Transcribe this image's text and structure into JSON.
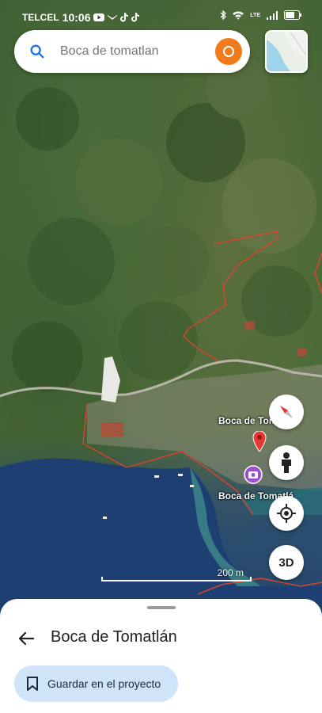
{
  "status_bar": {
    "carrier": "TELCEL",
    "time": "10:06",
    "network": "LTE"
  },
  "search": {
    "placeholder": "Boca de tomatlan"
  },
  "map": {
    "place_label_top": "Boca de Tom",
    "place_label_bottom": "Boca de Tomatlá",
    "scale_label": "200 m"
  },
  "controls": {
    "three_d_label": "3D"
  },
  "sheet": {
    "title": "Boca de Tomatlán",
    "save_label": "Guardar en el proyecto"
  },
  "colors": {
    "accent_orange": "#f27a1a",
    "pin_red": "#e53935",
    "photo_purple": "#9b4dca",
    "save_button_bg": "#cfe3f9",
    "boundary_red": "#d6452f"
  },
  "icons": [
    "youtube-icon",
    "tiktok-icon",
    "bluetooth-icon",
    "wifi-icon",
    "signal-icon",
    "battery-icon",
    "search-icon",
    "compass-icon",
    "pegman-icon",
    "my-location-icon",
    "back-arrow-icon",
    "bookmark-icon",
    "map-pin-icon",
    "camera-icon"
  ]
}
